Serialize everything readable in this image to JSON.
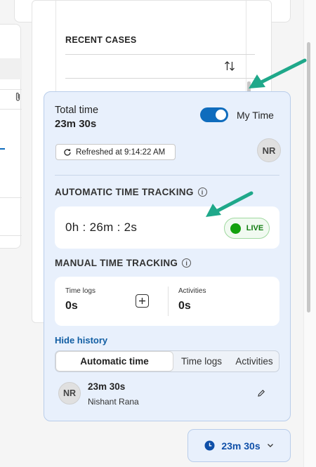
{
  "recent_cases": {
    "title": "RECENT CASES"
  },
  "time_panel": {
    "total_label": "Total time",
    "total_value": "23m 30s",
    "my_time_label": "My Time",
    "my_time_on": true,
    "refreshed_text": "Refreshed at 9:14:22 AM",
    "avatar_initials": "NR",
    "automatic": {
      "title": "AUTOMATIC TIME TRACKING",
      "time": "0h : 26m : 2s",
      "status": "LIVE"
    },
    "manual": {
      "title": "MANUAL TIME TRACKING",
      "time_logs_label": "Time logs",
      "time_logs_value": "0s",
      "activities_label": "Activities",
      "activities_value": "0s"
    },
    "hide_history": "Hide history",
    "tabs": [
      {
        "label": "Automatic time",
        "active": true
      },
      {
        "label": "Time logs",
        "active": false
      },
      {
        "label": "Activities",
        "active": false
      }
    ],
    "history": [
      {
        "initials": "NR",
        "time": "23m 30s",
        "name": "Nishant Rana"
      }
    ]
  },
  "time_button": {
    "label": "23m 30s"
  },
  "colors": {
    "accent": "#0f6cbd",
    "panel_bg": "#e8f0fc",
    "live_green": "#13a10e",
    "annotation_arrow": "#1fa88a"
  }
}
